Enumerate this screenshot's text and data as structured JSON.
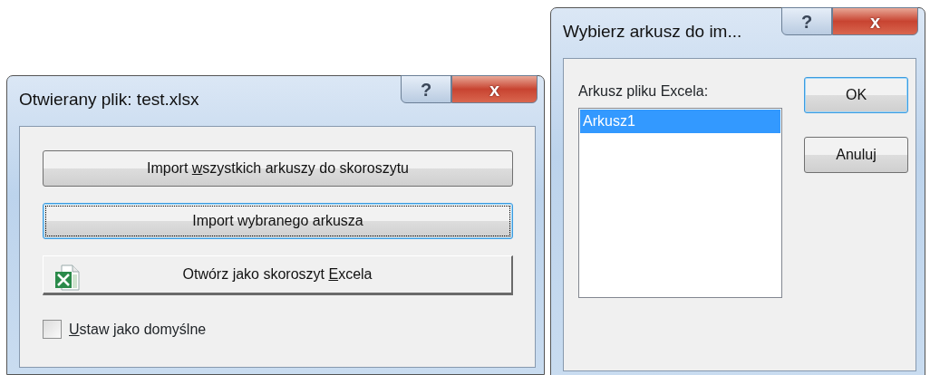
{
  "windows": [
    {
      "title": "Otwierany plik:  test.xlsx",
      "caption_buttons": [
        "?",
        "x"
      ],
      "buttons": [
        {
          "kind": "command",
          "label_parts": {
            "before": "Import ",
            "accesskey": "w",
            "after": "szystkich arkuszy do skoroszytu"
          },
          "focused": false
        },
        {
          "kind": "command",
          "label_parts": {
            "before": "Import wybranego arkusza"
          },
          "focused": true
        },
        {
          "kind": "icon",
          "label_parts": {
            "before": "Otwórz jako skoroszyt ",
            "accesskey": "E",
            "after": "xcela"
          },
          "focused": false
        }
      ],
      "checkbox": {
        "label_parts": {
          "accesskey": "U",
          "after": "staw jako domyślne"
        },
        "checked": false
      }
    },
    {
      "title": "Wybierz arkusz do im...",
      "caption_buttons": [
        "?",
        "x"
      ],
      "list_label": "Arkusz pliku Excela:",
      "list_items": [
        {
          "text": "Arkusz1",
          "selected": true
        }
      ],
      "buttons": [
        {
          "label": "OK",
          "focused": true
        },
        {
          "label": "Anuluj",
          "focused": false
        }
      ]
    }
  ]
}
